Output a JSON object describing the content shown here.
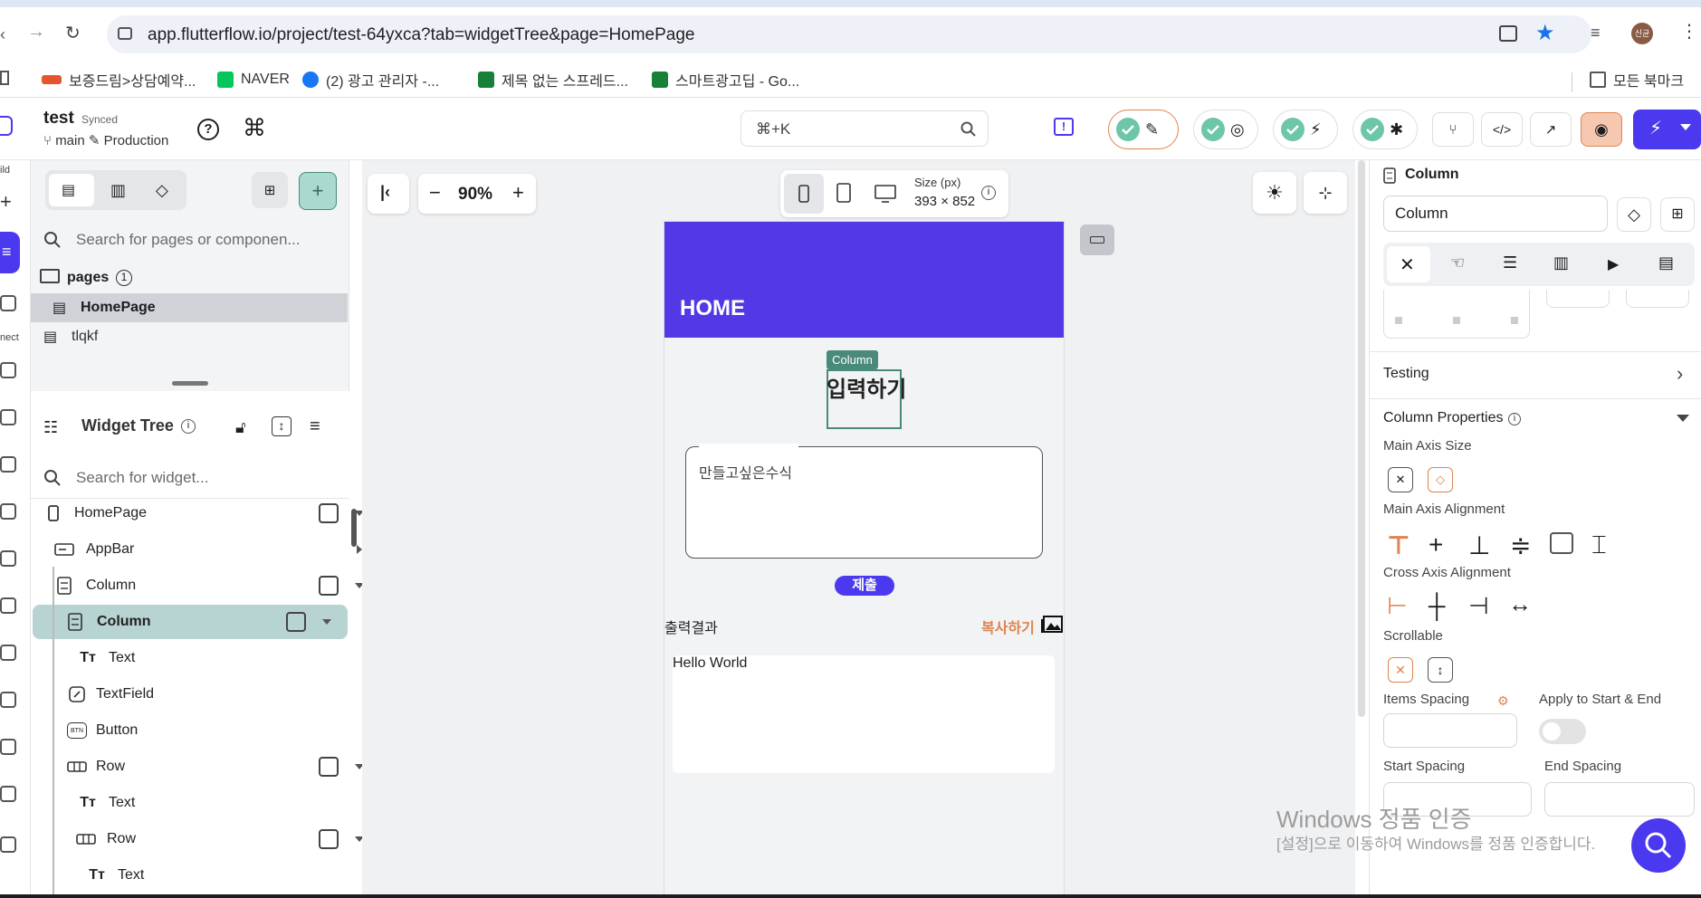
{
  "browser": {
    "url": "app.flutterflow.io/project/test-64yxca?tab=widgetTree&page=HomePage",
    "profile": "신균",
    "bookmarks": [
      {
        "label": "보증드림>상담예약...",
        "color": "#e4572e"
      },
      {
        "label": "NAVER",
        "color": "#03c75a"
      },
      {
        "label": "(2) 광고 관리자 -...",
        "color": "#1877f2"
      },
      {
        "label": "제목 없는 스프레드...",
        "color": "#188038"
      },
      {
        "label": "스마트광고딥 - Go...",
        "color": "#188038"
      }
    ],
    "all_bookmarks": "모든 북마크"
  },
  "header": {
    "project": "test",
    "synced": "Synced",
    "branch": "main",
    "env": "Production",
    "search_shortcut": "⌘+K"
  },
  "rail": {
    "build": "ild",
    "connect": "nect"
  },
  "left_panel": {
    "search_pages_placeholder": "Search for pages or componen...",
    "pages_label": "pages",
    "pages_count": "1",
    "pages": [
      "HomePage",
      "tlqkf"
    ],
    "widget_tree_title": "Widget Tree",
    "search_widget_placeholder": "Search for widget...",
    "tree": [
      {
        "label": "HomePage",
        "icon": "phone-icon"
      },
      {
        "label": "AppBar",
        "icon": "appbar-icon"
      },
      {
        "label": "Column",
        "icon": "column-icon"
      },
      {
        "label": "Column",
        "icon": "column-icon"
      },
      {
        "label": "Text",
        "icon": "text-icon"
      },
      {
        "label": "TextField",
        "icon": "textfield-icon"
      },
      {
        "label": "Button",
        "icon": "button-icon"
      },
      {
        "label": "Row",
        "icon": "row-icon"
      },
      {
        "label": "Text",
        "icon": "text-icon"
      },
      {
        "label": "Row",
        "icon": "row-icon"
      },
      {
        "label": "Text",
        "icon": "text-icon"
      }
    ],
    "button_icon_text": "BTN"
  },
  "canvas": {
    "zoom": "90%",
    "size_label": "Size (px)",
    "size_value": "393 × 852"
  },
  "phone": {
    "appbar_title": "HOME",
    "column_badge": "Column",
    "input_heading": "입력하기",
    "textfield_hint": "만들고싶은수식",
    "submit_label": "제출",
    "output_label": "출력결과",
    "copy_label": "복사하기",
    "result_text": "Hello World"
  },
  "right_panel": {
    "widget_type": "Column",
    "widget_name": "Column",
    "testing": "Testing",
    "column_properties": "Column Properties",
    "main_axis_size": "Main Axis Size",
    "main_axis_alignment": "Main Axis Alignment",
    "cross_axis_alignment": "Cross Axis Alignment",
    "scrollable": "Scrollable",
    "items_spacing": "Items Spacing",
    "apply_start_end": "Apply to Start & End",
    "start_spacing": "Start Spacing",
    "end_spacing": "End Spacing"
  },
  "watermark": {
    "line1": "Windows 정품 인증",
    "line2": "[설정]으로 이동하여 Windows를 정품 인증합니다."
  },
  "colors": {
    "accent": "#4b39ef",
    "teal": "#4a8a7a",
    "orange": "#e0834e"
  }
}
